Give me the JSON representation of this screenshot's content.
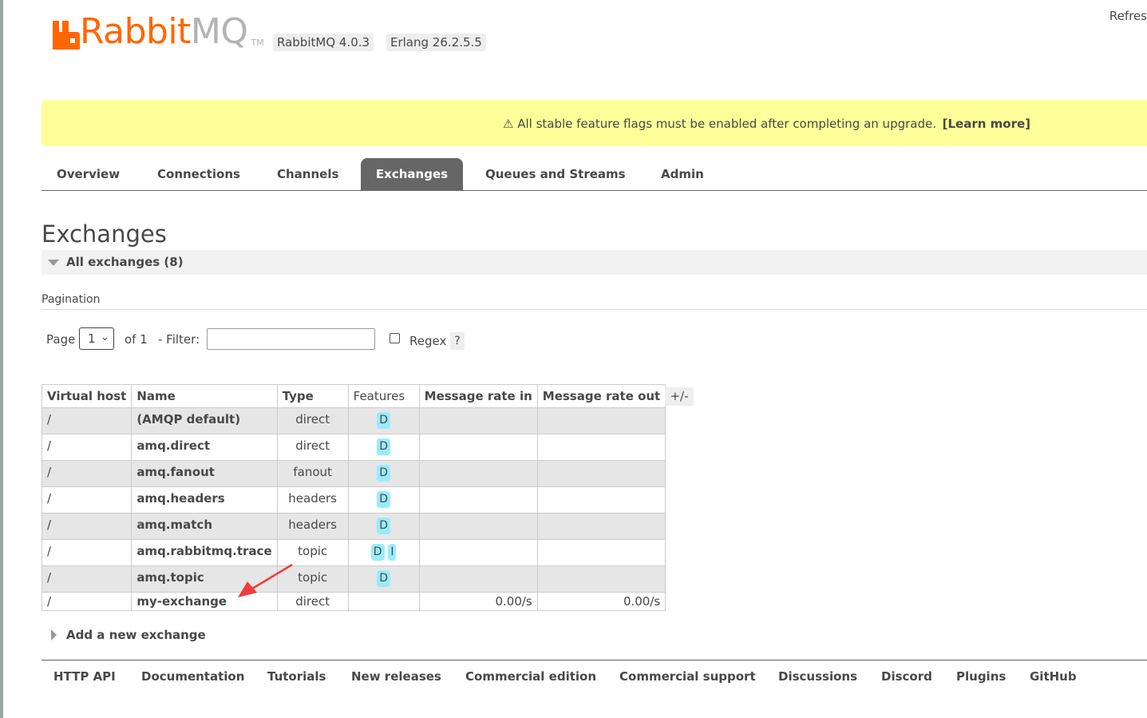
{
  "header": {
    "logo": {
      "brand_main": "Rabbit",
      "brand_accent": "MQ",
      "trademark": "TM",
      "colors": {
        "orange": "#ff6600",
        "grey": "#b3b3b3"
      }
    },
    "versions": [
      "RabbitMQ 4.0.3",
      "Erlang 26.2.5.5"
    ],
    "refresh_label": "Refres"
  },
  "warning_banner": {
    "icon": "warning-icon",
    "text": "⚠ All stable feature flags must be enabled after completing an upgrade.",
    "link": "[Learn more]",
    "background": "#ffff99"
  },
  "nav": {
    "tabs": [
      "Overview",
      "Connections",
      "Channels",
      "Exchanges",
      "Queues and Streams",
      "Admin"
    ],
    "active": "Exchanges"
  },
  "page": {
    "title": "Exchanges",
    "section_title": "All exchanges (8)"
  },
  "pagination": {
    "heading": "Pagination",
    "page_label": "Page",
    "current_page": "1",
    "of_label": "of 1",
    "filter_label": "- Filter:",
    "filter_value": "",
    "regex_label": "Regex",
    "regex_checked": false,
    "help_label": "?"
  },
  "table": {
    "headers": [
      "Virtual host",
      "Name",
      "Type",
      "Features",
      "Message rate in",
      "Message rate out"
    ],
    "columns_toggle": "+/-",
    "rows": [
      {
        "vhost": "/",
        "name": "(AMQP default)",
        "type": "direct",
        "features": [
          "D"
        ],
        "rate_in": "",
        "rate_out": ""
      },
      {
        "vhost": "/",
        "name": "amq.direct",
        "type": "direct",
        "features": [
          "D"
        ],
        "rate_in": "",
        "rate_out": ""
      },
      {
        "vhost": "/",
        "name": "amq.fanout",
        "type": "fanout",
        "features": [
          "D"
        ],
        "rate_in": "",
        "rate_out": ""
      },
      {
        "vhost": "/",
        "name": "amq.headers",
        "type": "headers",
        "features": [
          "D"
        ],
        "rate_in": "",
        "rate_out": ""
      },
      {
        "vhost": "/",
        "name": "amq.match",
        "type": "headers",
        "features": [
          "D"
        ],
        "rate_in": "",
        "rate_out": ""
      },
      {
        "vhost": "/",
        "name": "amq.rabbitmq.trace",
        "type": "topic",
        "features": [
          "D",
          "I"
        ],
        "rate_in": "",
        "rate_out": ""
      },
      {
        "vhost": "/",
        "name": "amq.topic",
        "type": "topic",
        "features": [
          "D"
        ],
        "rate_in": "",
        "rate_out": ""
      },
      {
        "vhost": "/",
        "name": "my-exchange",
        "type": "direct",
        "features": [],
        "rate_in": "0.00/s",
        "rate_out": "0.00/s"
      }
    ],
    "feature_chip_color": "#99ebff"
  },
  "add_exchange_label": "Add a new exchange",
  "footer": {
    "links": [
      "HTTP API",
      "Documentation",
      "Tutorials",
      "New releases",
      "Commercial edition",
      "Commercial support",
      "Discussions",
      "Discord",
      "Plugins",
      "GitHub"
    ]
  },
  "annotation": {
    "arrow_color": "#f03c3c"
  }
}
